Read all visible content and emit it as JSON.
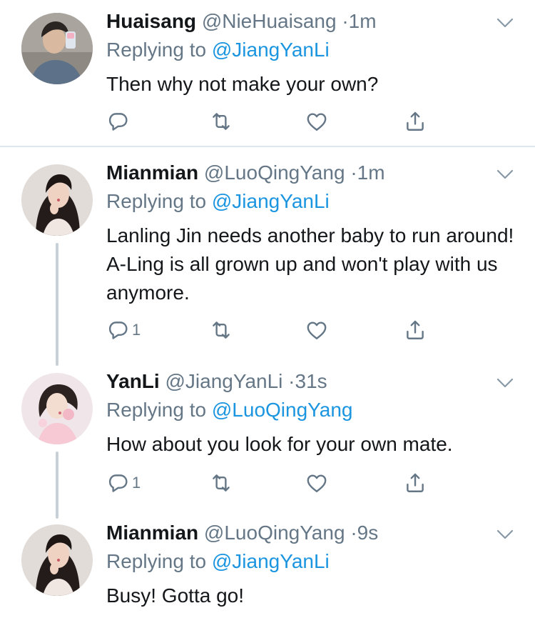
{
  "tweets": [
    {
      "name": "Huaisang",
      "handle": "@NieHuaisang",
      "sep": "·",
      "time": "1m",
      "replying_prefix": "Replying to",
      "replying_to": "@JiangYanLi",
      "text": "Then why not make your own?",
      "reply_count": ""
    },
    {
      "name": "Mianmian",
      "handle": "@LuoQingYang",
      "sep": "·",
      "time": "1m",
      "replying_prefix": "Replying to",
      "replying_to": "@JiangYanLi",
      "text": "Lanling Jin needs another baby to run around! A-Ling is all grown up and won't play with us anymore.",
      "reply_count": "1"
    },
    {
      "name": "YanLi",
      "handle": "@JiangYanLi",
      "sep": "·",
      "time": "31s",
      "replying_prefix": "Replying to",
      "replying_to": "@LuoQingYang",
      "text": "How about you look for your own mate.",
      "reply_count": "1"
    },
    {
      "name": "Mianmian",
      "handle": "@LuoQingYang",
      "sep": "·",
      "time": "9s",
      "replying_prefix": "Replying to",
      "replying_to": "@JiangYanLi",
      "text": "Busy! Gotta go!",
      "reply_count": ""
    }
  ],
  "colors": {
    "text": "#14171a",
    "muted": "#657786",
    "link": "#1b95e0",
    "thread_line": "#c9d1d8",
    "divider": "#e1e8ed"
  },
  "icons": [
    "reply-icon",
    "retweet-icon",
    "like-icon",
    "share-icon",
    "chevron-down-icon"
  ]
}
